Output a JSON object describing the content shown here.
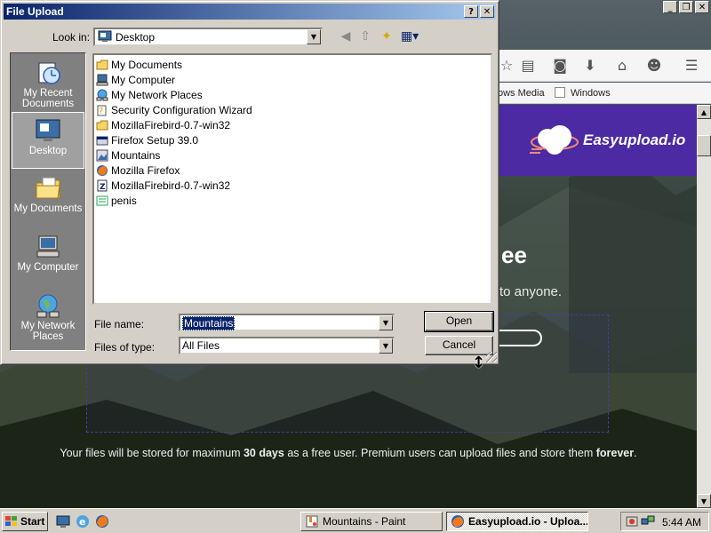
{
  "dialog": {
    "title": "File Upload",
    "help_glyph": "?",
    "close_glyph": "✕",
    "look_in_label": "Look in:",
    "look_in_value": "Desktop",
    "places": [
      {
        "label": "My Recent Documents",
        "icon": "recent-documents-icon"
      },
      {
        "label": "Desktop",
        "icon": "desktop-icon",
        "selected": true
      },
      {
        "label": "My Documents",
        "icon": "folder-icon"
      },
      {
        "label": "My Computer",
        "icon": "computer-icon"
      },
      {
        "label": "My Network Places",
        "icon": "network-icon"
      }
    ],
    "files": [
      {
        "name": "My Documents",
        "icon": "folder-icon"
      },
      {
        "name": "My Computer",
        "icon": "computer-icon"
      },
      {
        "name": "My Network Places",
        "icon": "network-icon"
      },
      {
        "name": "Security Configuration Wizard",
        "icon": "shortcut-icon"
      },
      {
        "name": "MozillaFirebird-0.7-win32",
        "icon": "folder-icon"
      },
      {
        "name": "Firefox Setup 39.0",
        "icon": "installer-icon"
      },
      {
        "name": "Mountains",
        "icon": "image-icon"
      },
      {
        "name": "Mozilla Firefox",
        "icon": "firefox-icon"
      },
      {
        "name": "MozillaFirebird-0.7-win32",
        "icon": "zip-icon"
      },
      {
        "name": "penis",
        "icon": "text-file-icon"
      }
    ],
    "file_name_label": "File name:",
    "file_name_value": "Mountains",
    "files_of_type_label": "Files of type:",
    "files_of_type_value": "All Files",
    "open_label": "Open",
    "cancel_label": "Cancel"
  },
  "browser": {
    "window_controls": [
      "_",
      "❐",
      "✕"
    ],
    "bookmarks": [
      "ows Media",
      "Windows"
    ],
    "site_name": "Easyupload.io",
    "hero_fragment": "ee",
    "hero_sub_fragment": "to anyone.",
    "footer": {
      "pre": "Your files will be stored for maximum ",
      "days": "30 days",
      "mid": " as a free user. Premium users can upload files and store them ",
      "forever": "forever",
      "post": "."
    }
  },
  "taskbar": {
    "start_label": "Start",
    "tasks": [
      {
        "label": "Mountains - Paint",
        "icon": "paint-icon",
        "active": false
      },
      {
        "label": "Easyupload.io - Uploa...",
        "icon": "firefox-icon",
        "active": true
      }
    ],
    "clock": "5:44 AM"
  },
  "colors": {
    "title_bar": "#0a246a",
    "site_header": "#4b2aa3",
    "dialog_face": "#d4d0c8"
  }
}
